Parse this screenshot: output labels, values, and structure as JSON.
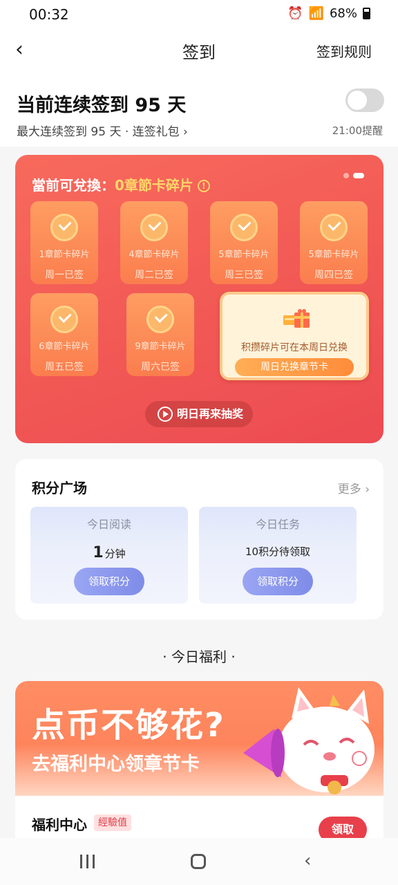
{
  "status_bar": {
    "time": "00:32",
    "battery": "68%"
  },
  "nav": {
    "title": "签到",
    "rules_link": "签到规则"
  },
  "header": {
    "streak_text": "当前连续签到 95 天",
    "sub_text": "最大连续签到 95 天 · 连签礼包 ›",
    "remind_time": "21:00提醒",
    "reminder_enabled": false
  },
  "sign_card": {
    "heading_prefix": "當前可兌換：",
    "heading_value": "0章節卡碎片",
    "tiles": [
      {
        "piece": "1章節卡碎片",
        "day": "周一已签"
      },
      {
        "piece": "4章節卡碎片",
        "day": "周二已签"
      },
      {
        "piece": "5章節卡碎片",
        "day": "周三已签"
      },
      {
        "piece": "5章節卡碎片",
        "day": "周四已签"
      },
      {
        "piece": "6章節卡碎片",
        "day": "周五已签"
      },
      {
        "piece": "9章節卡碎片",
        "day": "周六已签"
      }
    ],
    "sunday_message": "积攒碎片可在本周日兑换",
    "sunday_button": "周日兑换章节卡",
    "lottery_button": "明日再来抽奖",
    "carousel_dots": 2,
    "active_dot": 2
  },
  "points": {
    "title": "积分广场",
    "more": "更多 ›",
    "reading": {
      "header": "今日阅读",
      "value": "1",
      "unit": "分钟",
      "button": "领取积分"
    },
    "tasks": {
      "header": "今日任务",
      "value": "10积分待领取",
      "button": "领取积分"
    }
  },
  "welfare": {
    "section_title": "· 今日福利 ·",
    "banner_big": "点币不够花?",
    "banner_small": "去福利中心领章节卡",
    "item_title": "福利中心",
    "badge": "經驗值",
    "claim_button": "領取"
  },
  "colors": {
    "card_red": "#f25a55",
    "tile_orange": "#fb7d4e",
    "highlight_yellow": "#ffd76a",
    "points_button": "#7e8ce8",
    "claim_red": "#e8404a"
  }
}
